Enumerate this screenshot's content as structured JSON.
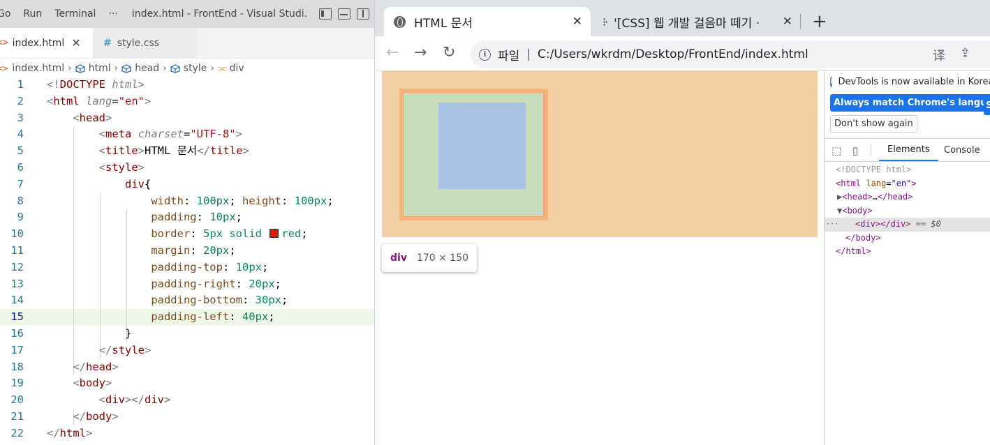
{
  "vscode": {
    "menu": [
      "Go",
      "Run",
      "Terminal",
      "···"
    ],
    "window_title": "index.html - FrontEnd - Visual Studi...",
    "tabs": [
      {
        "label": "index.html",
        "active": true
      },
      {
        "label": "style.css",
        "active": false
      }
    ],
    "breadcrumb": [
      "index.html",
      "html",
      "head",
      "style",
      "div"
    ],
    "highlighted_line": 15,
    "lines": [
      {
        "n": "1",
        "html": "<span class='pn'>&lt;!</span><span class='t'>DOCTYPE</span> <span class='a' style='font-style:italic;color:#808080'>html</span><span class='pn'>&gt;</span>"
      },
      {
        "n": "2",
        "html": "<span class='pn'>&lt;</span><span class='t'>html</span> <span class='a' style='font-style:italic;color:#808080'>lang</span>=<span class='s' style='color:#a31515'>\"en\"</span><span class='pn'>&gt;</span>"
      },
      {
        "n": "3",
        "html": "    <span class='pn'>&lt;</span><span class='t'>head</span><span class='pn'>&gt;</span>"
      },
      {
        "n": "4",
        "html": "        <span class='pn'>&lt;</span><span class='t'>meta</span> <span style='font-style:italic;color:#808080'>charset</span>=<span style='color:#a31515'>\"UTF-8\"</span><span class='pn'>&gt;</span>"
      },
      {
        "n": "5",
        "html": "        <span class='pn'>&lt;</span><span class='t'>title</span><span class='pn'>&gt;</span>HTML 문서<span class='pn'>&lt;/</span><span class='t'>title</span><span class='pn'>&gt;</span>"
      },
      {
        "n": "6",
        "html": "        <span class='pn'>&lt;</span><span class='t'>style</span><span class='pn'>&gt;</span>"
      },
      {
        "n": "7",
        "html": "            <span class='kw'>div</span>{"
      },
      {
        "n": "8",
        "html": "                <span class='cx' style='color:#7a4a1a'>width</span>: <span class='cv'>100</span><span class='cu'>px</span>; <span style='color:#7a4a1a'>height</span>: <span class='cv'>100</span><span class='cu'>px</span>;"
      },
      {
        "n": "9",
        "html": "                <span style='color:#7a4a1a'>padding</span>: <span class='cv'>10</span><span class='cu'>px</span>;"
      },
      {
        "n": "10",
        "html": "                <span style='color:#7a4a1a'>border</span>: <span class='cv'>5</span><span class='cu'>px</span> <span class='cv'>solid</span> <span class='sw' style='background:#e51400'></span><span class='cv'>red</span>;"
      },
      {
        "n": "11",
        "html": "                <span style='color:#7a4a1a'>margin</span>: <span class='cv'>20</span><span class='cu'>px</span>;"
      },
      {
        "n": "12",
        "html": "                <span style='color:#7a4a1a'>padding-top</span>: <span class='cv'>10</span><span class='cu'>px</span>;"
      },
      {
        "n": "13",
        "html": "                <span style='color:#7a4a1a'>padding-right</span>: <span class='cv'>20</span><span class='cu'>px</span>;"
      },
      {
        "n": "14",
        "html": "                <span style='color:#7a4a1a'>padding-bottom</span>: <span class='cv'>30</span><span class='cu'>px</span>;"
      },
      {
        "n": "15",
        "html": "                <span style='color:#7a4a1a'>padding-left</span>: <span class='cv'>40</span><span class='cu'>px</span>;"
      },
      {
        "n": "16",
        "html": "            }"
      },
      {
        "n": "17",
        "html": "        <span class='pn'>&lt;/</span><span class='t'>style</span><span class='pn'>&gt;</span>"
      },
      {
        "n": "18",
        "html": "    <span class='pn'>&lt;/</span><span class='t'>head</span><span class='pn'>&gt;</span>"
      },
      {
        "n": "19",
        "html": "    <span class='pn'>&lt;</span><span class='t'>body</span><span class='pn'>&gt;</span>"
      },
      {
        "n": "20",
        "html": "        <span class='pn'>&lt;</span><span class='t'>div</span><span class='pn'>&gt;&lt;/</span><span class='t'>div</span><span class='pn'>&gt;</span>"
      },
      {
        "n": "21",
        "html": "    <span class='pn'>&lt;/</span><span class='t'>body</span><span class='pn'>&gt;</span>"
      },
      {
        "n": "22",
        "html": "<span class='pn'>&lt;/</span><span class='t'>html</span><span class='pn'>&gt;</span>"
      }
    ]
  },
  "chrome": {
    "tabs": [
      {
        "title": "HTML 문서",
        "active": true
      },
      {
        "title": "'[CSS] 웹 개발 걸음마 떼기 ·",
        "active": false
      }
    ],
    "address_prefix": "파일",
    "address": "C:/Users/wkrdm/Desktop/FrontEnd/index.html",
    "tooltip_tag": "div",
    "tooltip_dims": "170 × 150"
  },
  "devtools": {
    "banner_message": "DevTools is now available in Korean",
    "btn_match": "Always match Chrome's language",
    "btn_match_cut": "S",
    "btn_dont_show": "Don't show again",
    "tabs": [
      "Elements",
      "Console"
    ],
    "tree": [
      {
        "html": "<span class='td'>&lt;!DOCTYPE html&gt;</span>",
        "indent": 16
      },
      {
        "html": "<span class='tg'>&lt;html</span> <span class='ta'>lang</span>=<span class='tv'>\"en\"</span><span class='tg'>&gt;</span>",
        "indent": 16
      },
      {
        "html": "<span style='color:#555'>▶</span><span class='tg'>&lt;head&gt;</span>…<span class='tg'>&lt;/head&gt;</span>",
        "indent": 18
      },
      {
        "html": "<span style='color:#555'>▼</span><span class='tg'>&lt;body&gt;</span>",
        "indent": 18
      },
      {
        "html": "<span class='tg'>&lt;div&gt;&lt;/div&gt;</span> <span style='color:#555'>==</span> <span style='color:#555;font-style:italic'>$0</span>",
        "indent": 44,
        "selected": true
      },
      {
        "html": "<span class='tg'>&lt;/body&gt;</span>",
        "indent": 30
      },
      {
        "html": "<span class='tg'>&lt;/html&gt;</span>",
        "indent": 16
      }
    ]
  },
  "colors": {
    "accent": "#1a73e8",
    "css_red": "#e51400"
  },
  "icons": [
    "layout-sidebar-icon",
    "layout-panel-icon",
    "layout-split-icon",
    "globe-icon",
    "back-arrow-icon",
    "forward-arrow-icon",
    "reload-icon",
    "info-icon",
    "translate-icon",
    "share-icon",
    "inspect-icon",
    "device-icon"
  ]
}
